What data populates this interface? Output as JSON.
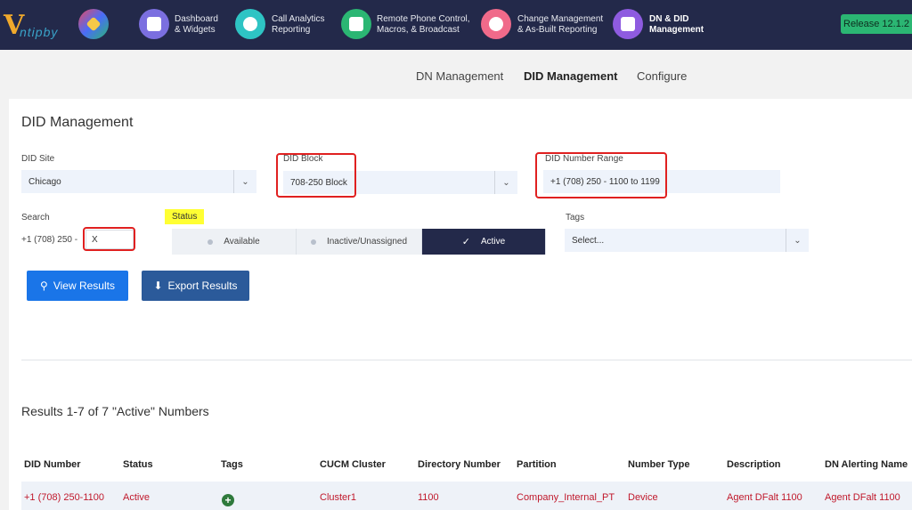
{
  "app": {
    "logo_text": "ntipby",
    "release": "Release 12.1.2",
    "nav": [
      {
        "line1": "Dashboard",
        "line2": "& Widgets",
        "color": "#7b6fe0"
      },
      {
        "line1": "Call Analytics",
        "line2": "Reporting",
        "color": "#2ec4c4"
      },
      {
        "line1": "Remote Phone Control,",
        "line2": "Macros, & Broadcast",
        "color": "#2bb673"
      },
      {
        "line1": "Change Management",
        "line2": "& As-Built Reporting",
        "color": "#f06a8a"
      },
      {
        "line1": "DN & DID",
        "line2": "Management",
        "color": "#8e5be0"
      }
    ]
  },
  "subnav": {
    "dn_management": "DN Management",
    "did_management": "DID Management",
    "configure": "Configure"
  },
  "page": {
    "title": "DID Management",
    "did_site": {
      "label": "DID Site",
      "value": "Chicago"
    },
    "did_block": {
      "label": "DID Block",
      "value": "708-250 Block"
    },
    "did_range": {
      "label": "DID Number Range",
      "value": "+1 (708) 250 - 1100 to 1199"
    },
    "search": {
      "label": "Search",
      "prefix": "+1 (708) 250 -",
      "value": "X"
    },
    "status": {
      "label": "Status",
      "options": [
        "Available",
        "Inactive/Unassigned",
        "Active"
      ],
      "selected": "Active"
    },
    "tags": {
      "label": "Tags",
      "placeholder": "Select..."
    },
    "view_results": "View Results",
    "export_results": "Export Results",
    "results_title": "Results 1-7 of 7 \"Active\" Numbers"
  },
  "table": {
    "columns": [
      "DID Number",
      "Status",
      "Tags",
      "CUCM Cluster",
      "Directory Number",
      "Partition",
      "Number Type",
      "Description",
      "DN Alerting Name"
    ],
    "rows": [
      {
        "did_number": "+1 (708) 250-1100",
        "status": "Active",
        "tags": "+",
        "cluster": "Cluster1",
        "directory_number": "1100",
        "partition": "Company_Internal_PT",
        "number_type": "Device",
        "description": "Agent DFalt 1100",
        "alerting_name": "Agent DFalt 1100"
      }
    ]
  }
}
